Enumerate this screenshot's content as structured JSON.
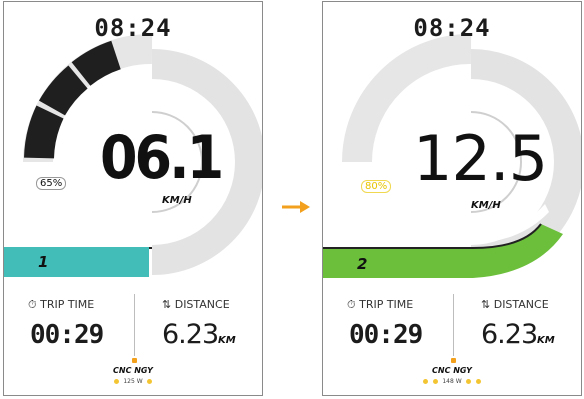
{
  "screens": [
    {
      "clock": "08:24",
      "speed": "06.1",
      "speed_unit": "KM/H",
      "assist_percent": "65%",
      "assist_level": "1",
      "level_color": "#43bdb7",
      "trip_time_label": "TRIP TIME",
      "trip_time_value": "00:29",
      "distance_label": "DISTANCE",
      "distance_value": "6.23",
      "distance_unit": "KM",
      "brand": "CNC NGY",
      "power": "125 W",
      "gauge_fill_fraction": 0.4
    },
    {
      "clock": "08:24",
      "speed": "12.5",
      "speed_unit": "KM/H",
      "assist_percent": "80%",
      "assist_level": "2",
      "level_color": "#6cbf3b",
      "trip_time_label": "TRIP TIME",
      "trip_time_value": "00:29",
      "distance_label": "DISTANCE",
      "distance_value": "6.23",
      "distance_unit": "KM",
      "brand": "CNC NGY",
      "power": "148 W",
      "gauge_fill_fraction": 0.0
    }
  ],
  "colors": {
    "arrow": "#f2a01d",
    "gauge_track": "#e3e3e3",
    "gauge_fill": "#1f1f1f",
    "power_dot": "#f3c533"
  }
}
